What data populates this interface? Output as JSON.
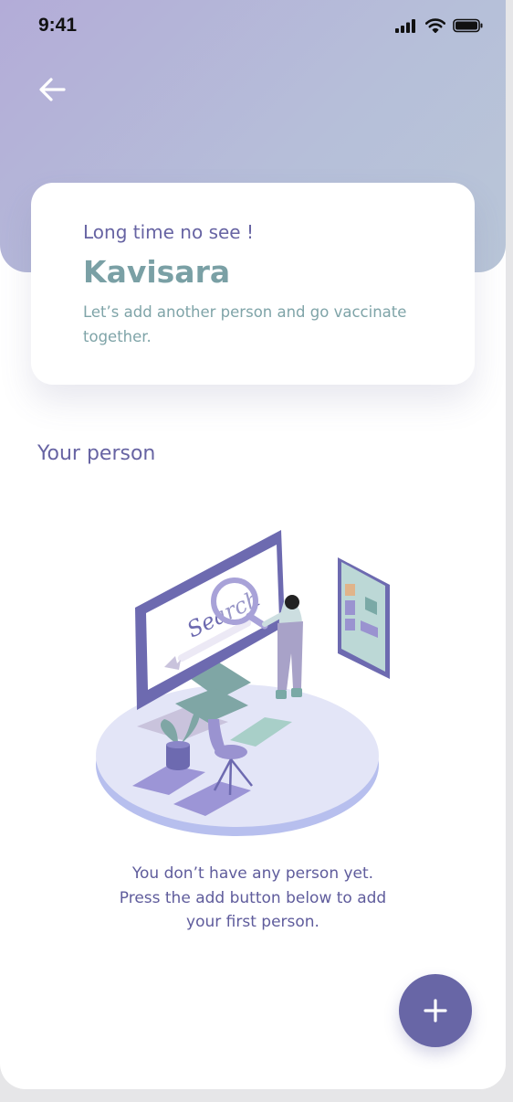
{
  "status_bar": {
    "time": "9:41"
  },
  "header": {
    "back_icon": "arrow-left-icon"
  },
  "welcome_card": {
    "greeting": "Long time no see !",
    "name": "Kavisara",
    "message": "Let’s add another person and go vaccinate together."
  },
  "section": {
    "title": "Your person"
  },
  "empty_state": {
    "line1": "You don’t have any person yet.",
    "line2": "Press the add button below to add",
    "line3": "your first person.",
    "illustration_search_word": "Search"
  },
  "fab": {
    "icon": "plus-icon"
  },
  "colors": {
    "accent": "#6866a6",
    "teal_text": "#7aa0a5",
    "header_gradient_start": "#b3acd8",
    "header_gradient_end": "#b9c6d8"
  }
}
